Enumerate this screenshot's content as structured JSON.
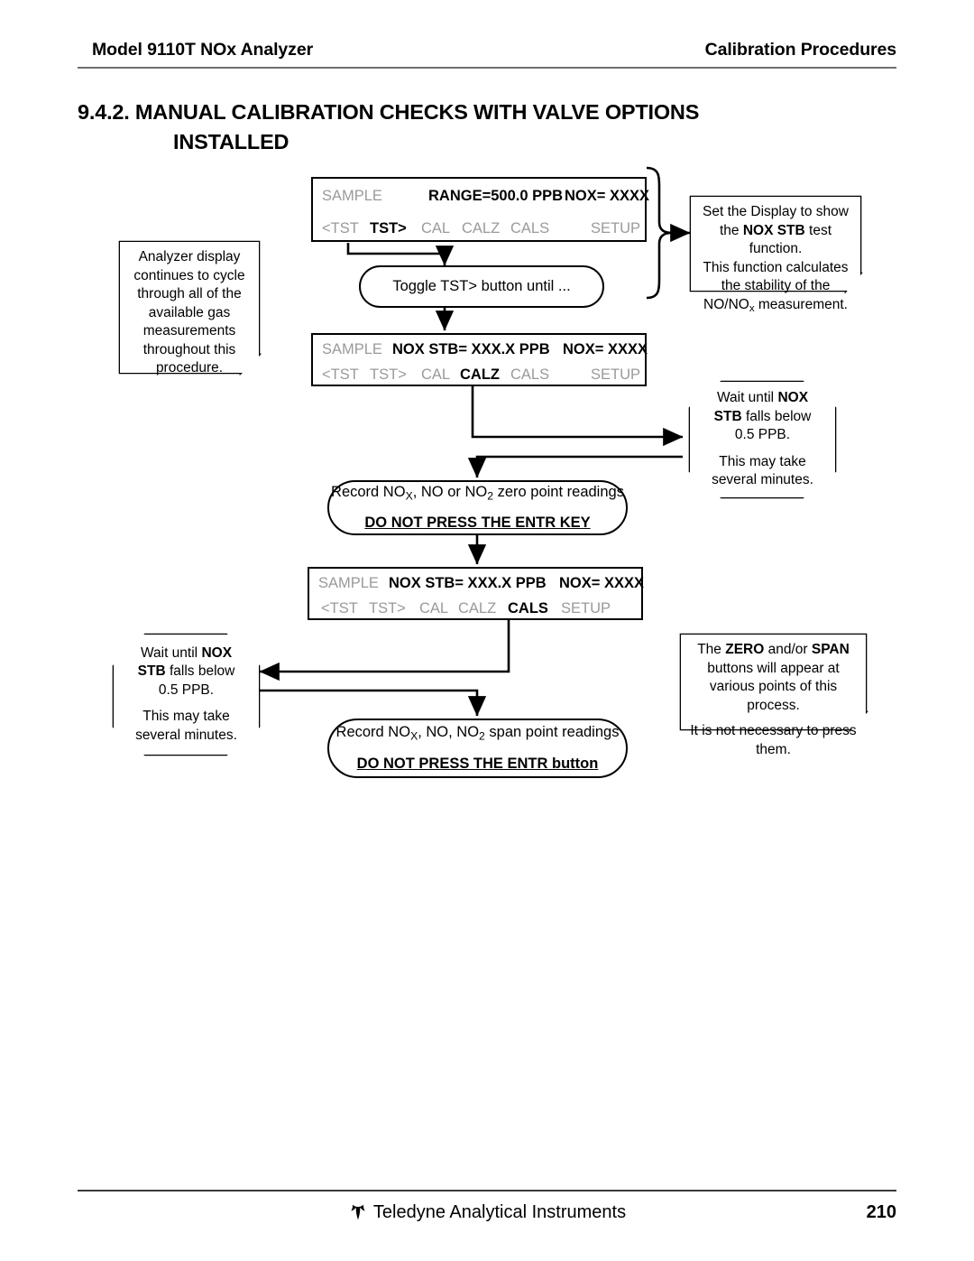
{
  "header": {
    "left": "Model 9110T NOx Analyzer",
    "right": "Calibration Procedures"
  },
  "section": {
    "line1": "9.4.2. MANUAL CALIBRATION CHECKS WITH VALVE OPTIONS",
    "line2": "INSTALLED"
  },
  "panels": [
    {
      "id": "panel-range",
      "status": "SAMPLE",
      "reading": "RANGE=500.0 PPB",
      "nox": "NOX= XXXX",
      "buttons": [
        "<TST",
        "TST>",
        "CAL",
        "CALZ",
        "CALS",
        "SETUP"
      ],
      "active_button": "TST>"
    },
    {
      "id": "panel-calz",
      "status": "SAMPLE",
      "reading": "NOX STB= XXX.X PPB",
      "nox": "NOX= XXXX",
      "buttons": [
        "<TST",
        "TST>",
        "CAL",
        "CALZ",
        "CALS",
        "SETUP"
      ],
      "active_button": "CALZ"
    },
    {
      "id": "panel-cals",
      "status": "SAMPLE",
      "reading": "NOX STB= XXX.X PPB",
      "nox": "NOX= XXXX",
      "buttons": [
        "<TST",
        "TST>",
        "CAL",
        "CALZ",
        "CALS",
        "SETUP"
      ],
      "active_button": "CALS"
    }
  ],
  "steps": {
    "toggle": "Toggle TST> button until ...",
    "record_zero_line1": "Record NOₓ, NO or NO₂ zero point readings",
    "record_zero_line2": "DO NOT PRESS THE ENTR KEY",
    "record_span_line1": "Record NOₓ, NO, NO₂ span point readings",
    "record_span_line2": "DO NOT PRESS THE ENTR button"
  },
  "notes": {
    "analyzer_display": "Analyzer display continues to cycle through all of the available gas measurements throughout this procedure.",
    "set_display_p1_a": "Set the Display to show the ",
    "set_display_p1_b": "NOX STB",
    "set_display_p1_c": " test function.",
    "set_display_p2_a": "This function calculates the stability of the NO/NO",
    "set_display_p2_sub": "x",
    "set_display_p2_b": " measurement.",
    "zero_span_p1_a": "The ",
    "zero_span_p1_zero": "ZERO",
    "zero_span_p1_b": " and/or ",
    "zero_span_p1_span": "SPAN",
    "zero_span_p1_c": " buttons will appear at various points of this process.",
    "zero_span_p2": "It is not necessary to press them."
  },
  "wait_callout": {
    "p1_a": "Wait until ",
    "p1_b": "NOX STB",
    "p1_c": " falls below 0.5 PPB.",
    "p2": "This may take several minutes."
  },
  "footer": {
    "company": "Teledyne Analytical Instruments",
    "page": "210",
    "logo": "teledyne-logo-icon"
  },
  "colors": {
    "ink": "#000000",
    "dim_segment": "#9a9a9a",
    "rule": "#6f6f6f"
  }
}
